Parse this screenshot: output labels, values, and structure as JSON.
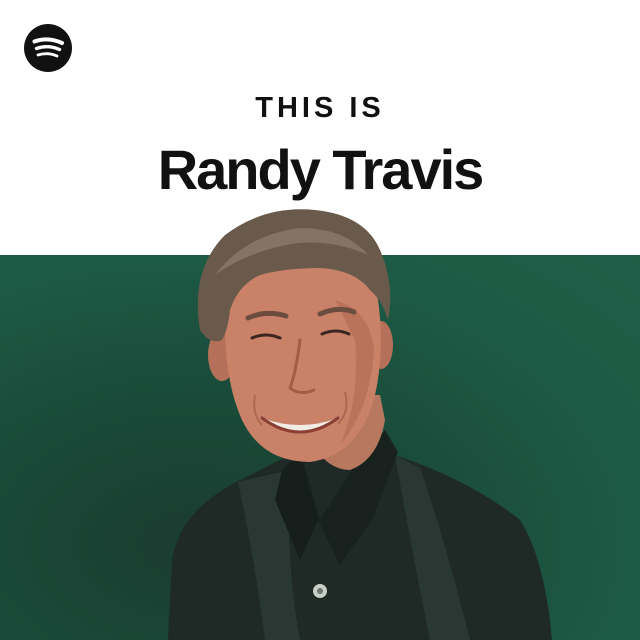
{
  "cover": {
    "brand_icon": "spotify-logo-icon",
    "overline": "THIS IS",
    "title": "Randy Travis",
    "artist_image": "artist-portrait",
    "colors": {
      "top_background": "#ffffff",
      "photo_background": "#1d5a45",
      "text": "#111111",
      "logo": "#111111"
    }
  }
}
